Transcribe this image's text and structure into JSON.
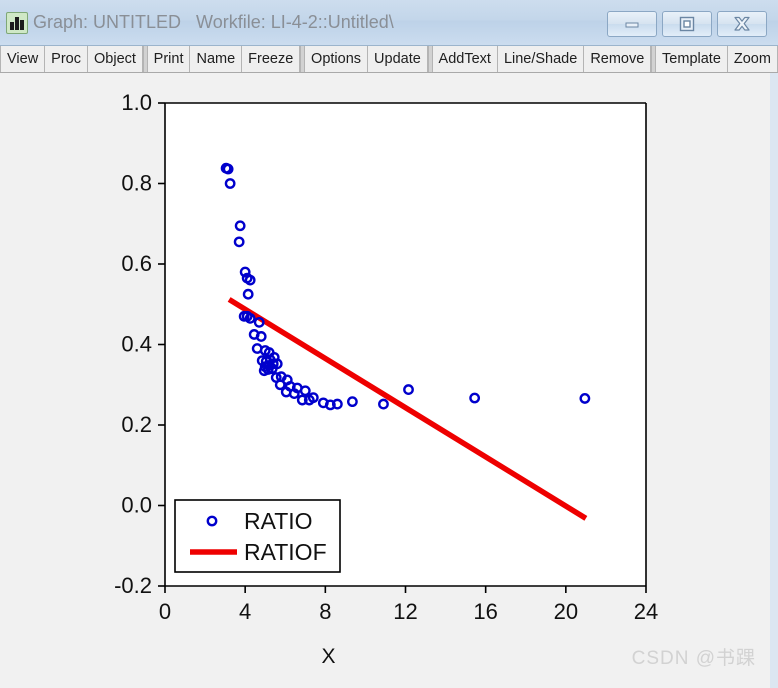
{
  "window": {
    "title": "Graph: UNTITLED   Workfile: LI-4-2::Untitled\\",
    "icon": "bar-chart-icon",
    "controls": {
      "minimize": "minimize-icon",
      "maximize": "maximize-icon",
      "close": "close-icon"
    }
  },
  "toolbar": {
    "groups": [
      {
        "items": [
          "View",
          "Proc",
          "Object"
        ]
      },
      {
        "items": [
          "Print",
          "Name",
          "Freeze"
        ]
      },
      {
        "items": [
          "Options",
          "Update"
        ]
      },
      {
        "items": [
          "AddText",
          "Line/Shade",
          "Remove"
        ]
      },
      {
        "items": [
          "Template",
          "Zoom"
        ]
      }
    ]
  },
  "watermark": "CSDN @书踝",
  "chart_data": {
    "type": "scatter",
    "title": "",
    "xlabel": "X",
    "ylabel": "",
    "xlim": [
      0,
      24
    ],
    "ylim": [
      -0.2,
      1.0
    ],
    "xticks": [
      0,
      4,
      8,
      12,
      16,
      20,
      24
    ],
    "yticks": [
      1.0,
      0.8,
      0.6,
      0.4,
      0.2,
      0.0,
      -0.2
    ],
    "ytick_labels": [
      "1.0",
      "0.8",
      "0.6",
      "0.4",
      "0.2",
      "0.0",
      "-0.2"
    ],
    "xtick_labels": [
      "0",
      "4",
      "8",
      "12",
      "16",
      "20",
      "24"
    ],
    "grid": false,
    "legend_position": "lower-left",
    "series": [
      {
        "name": "RATIO",
        "type": "scatter",
        "marker": "open-circle",
        "color": "#0000cc",
        "points": [
          [
            3.05,
            0.838
          ],
          [
            3.15,
            0.836
          ],
          [
            3.25,
            0.8
          ],
          [
            3.75,
            0.695
          ],
          [
            3.7,
            0.655
          ],
          [
            4.0,
            0.58
          ],
          [
            4.1,
            0.565
          ],
          [
            4.25,
            0.56
          ],
          [
            4.15,
            0.525
          ],
          [
            3.95,
            0.47
          ],
          [
            4.1,
            0.47
          ],
          [
            4.25,
            0.465
          ],
          [
            4.7,
            0.455
          ],
          [
            4.45,
            0.425
          ],
          [
            4.8,
            0.42
          ],
          [
            4.6,
            0.39
          ],
          [
            5.0,
            0.385
          ],
          [
            5.2,
            0.38
          ],
          [
            4.85,
            0.36
          ],
          [
            5.05,
            0.358
          ],
          [
            5.25,
            0.362
          ],
          [
            5.45,
            0.368
          ],
          [
            5.0,
            0.345
          ],
          [
            5.2,
            0.348
          ],
          [
            5.4,
            0.352
          ],
          [
            5.6,
            0.352
          ],
          [
            4.95,
            0.335
          ],
          [
            5.15,
            0.338
          ],
          [
            5.35,
            0.34
          ],
          [
            5.55,
            0.318
          ],
          [
            5.8,
            0.32
          ],
          [
            6.1,
            0.312
          ],
          [
            5.75,
            0.3
          ],
          [
            6.25,
            0.296
          ],
          [
            6.6,
            0.292
          ],
          [
            6.05,
            0.282
          ],
          [
            6.45,
            0.278
          ],
          [
            7.0,
            0.285
          ],
          [
            6.85,
            0.262
          ],
          [
            7.2,
            0.262
          ],
          [
            7.4,
            0.268
          ],
          [
            7.9,
            0.255
          ],
          [
            8.25,
            0.25
          ],
          [
            8.6,
            0.252
          ],
          [
            9.35,
            0.258
          ],
          [
            10.9,
            0.252
          ],
          [
            12.15,
            0.288
          ],
          [
            15.45,
            0.267
          ],
          [
            20.95,
            0.266
          ]
        ]
      },
      {
        "name": "RATIOF",
        "type": "line",
        "color": "#ee0000",
        "line": {
          "x": [
            3.2,
            21.0
          ],
          "y": [
            0.512,
            -0.032
          ]
        }
      }
    ]
  }
}
